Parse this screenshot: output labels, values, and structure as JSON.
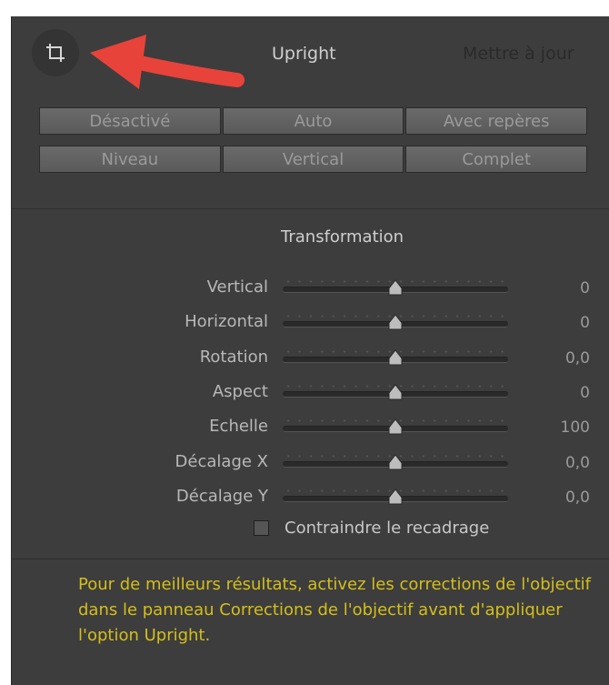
{
  "panel": {
    "title": "Upright",
    "update_link": "Mettre à jour",
    "crop_icon": "crop-overlay-icon"
  },
  "upright_modes": {
    "row1": [
      "Désactivé",
      "Auto",
      "Avec repères"
    ],
    "row2": [
      "Niveau",
      "Vertical",
      "Complet"
    ]
  },
  "transform": {
    "title": "Transformation",
    "sliders": [
      {
        "label": "Vertical",
        "value": "0",
        "position": 0.5
      },
      {
        "label": "Horizontal",
        "value": "0",
        "position": 0.5
      },
      {
        "label": "Rotation",
        "value": "0,0",
        "position": 0.5
      },
      {
        "label": "Aspect",
        "value": "0",
        "position": 0.5
      },
      {
        "label": "Echelle",
        "value": "100",
        "position": 0.5
      },
      {
        "label": "Décalage X",
        "value": "0,0",
        "position": 0.5
      },
      {
        "label": "Décalage Y",
        "value": "0,0",
        "position": 0.5
      }
    ]
  },
  "constrain_crop": {
    "label": "Contraindre le recadrage",
    "checked": false
  },
  "notice": {
    "text": "Pour de meilleurs résultats, activez les corrections de l'objectif dans le panneau Corrections de l'objectif avant d'appliquer l'option Upright."
  },
  "colors": {
    "panel_bg": "#3d3d3d",
    "notice_text": "#d4bf1c",
    "arrow": "#e8433a"
  }
}
